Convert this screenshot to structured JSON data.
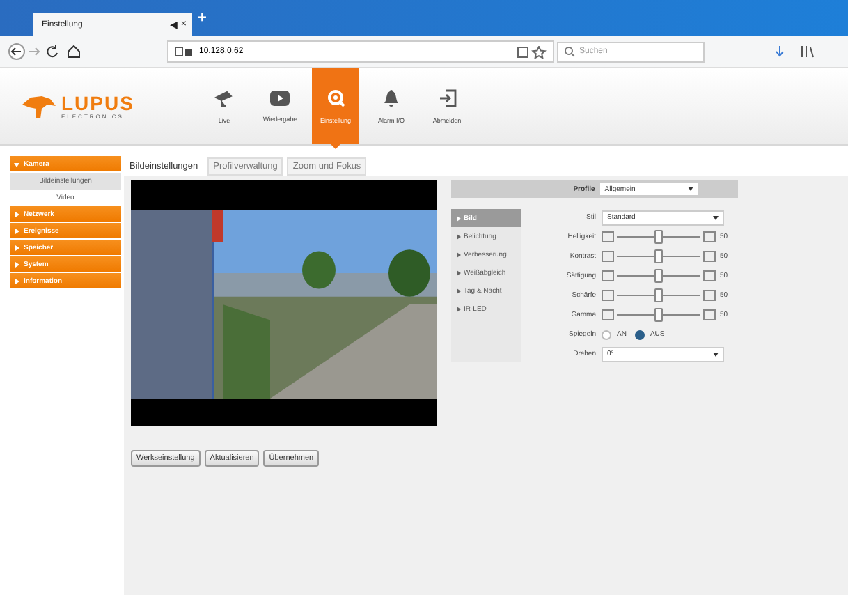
{
  "browser": {
    "tab_title": "Einstellung",
    "tab_audio": "◀",
    "tab_close": "×",
    "new_tab": "+",
    "address": "10.128.0.62",
    "address_dash": "—",
    "search_placeholder": "Suchen"
  },
  "nav": [
    {
      "label": "Live",
      "kind": "camera",
      "selected": false
    },
    {
      "label": "Wiedergabe",
      "kind": "play",
      "selected": false
    },
    {
      "label": "Einstellung",
      "kind": "gear",
      "selected": true
    },
    {
      "label": "Alarm I/O",
      "kind": "bell",
      "selected": false
    },
    {
      "label": "Abmelden",
      "kind": "exit",
      "selected": false
    }
  ],
  "logo": {
    "name": "LUPUS",
    "sub": "ELECTRONICS"
  },
  "sidebar": [
    {
      "label": "Kamera",
      "expanded": true,
      "children": [
        {
          "label": "Bildeinstellungen",
          "selected": true
        },
        {
          "label": "Video",
          "selected": false
        }
      ]
    },
    {
      "label": "Netzwerk",
      "expanded": false
    },
    {
      "label": "Ereignisse",
      "expanded": false
    },
    {
      "label": "Speicher",
      "expanded": false
    },
    {
      "label": "System",
      "expanded": false
    },
    {
      "label": "Information",
      "expanded": false
    }
  ],
  "tabs": [
    {
      "label": "Bildeinstellungen",
      "selected": true
    },
    {
      "label": "Profilverwaltung",
      "selected": false
    },
    {
      "label": "Zoom und Fokus",
      "selected": false
    }
  ],
  "profile": {
    "label": "Profile",
    "value": "Allgemein"
  },
  "settings_menu": [
    {
      "label": "Bild",
      "selected": true
    },
    {
      "label": "Belichtung",
      "selected": false
    },
    {
      "label": "Verbesserung",
      "selected": false
    },
    {
      "label": "Weißabgleich",
      "selected": false
    },
    {
      "label": "Tag & Nacht",
      "selected": false
    },
    {
      "label": "IR-LED",
      "selected": false
    }
  ],
  "style": {
    "label": "Stil",
    "value": "Standard"
  },
  "sliders": [
    {
      "label": "Helligkeit",
      "level": 0.5,
      "reading": "50"
    },
    {
      "label": "Kontrast",
      "level": 0.5,
      "reading": "50"
    },
    {
      "label": "Sättigung",
      "level": 0.5,
      "reading": "50"
    },
    {
      "label": "Schärfe",
      "level": 0.5,
      "reading": "50"
    },
    {
      "label": "Gamma",
      "level": 0.5,
      "reading": "50"
    }
  ],
  "mirror": {
    "label": "Spiegeln",
    "options": [
      {
        "label": "AN",
        "selected": false
      },
      {
        "label": "AUS",
        "selected": true
      }
    ]
  },
  "rotate": {
    "label": "Drehen",
    "value": "0°"
  },
  "buttons": [
    "Werkseinstellung",
    "Aktualisieren",
    "Übernehmen"
  ]
}
